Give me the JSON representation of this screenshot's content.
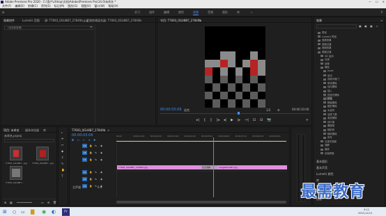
{
  "window": {
    "title": "Adobe Premiere Pro 2020 - C:\\用户\\cfdrop\\文档\\Adobe\\Premiere Pro\\14.0\\未命名 *",
    "controls": [
      "—",
      "☐",
      "✕"
    ]
  },
  "menu": [
    "文件(F)",
    "编辑(E)",
    "剪辑(C)",
    "序列(S)",
    "标记(M)",
    "图形(G)",
    "视图(V)",
    "窗口(W)",
    "帮助(H)"
  ],
  "workspaces": {
    "tabs": [
      "学习",
      "组件",
      "编辑",
      "颜色",
      "效果",
      "音频",
      "图形",
      "库"
    ],
    "active": "效果",
    "more": "»"
  },
  "effect_controls_panel": {
    "tabs": [
      "效果控件",
      "Lumetri 范围",
      "源: T7693_0GU8B7_27849b.jpg",
      "音频剪辑混合器: T7693_0GU8B7_27849b"
    ],
    "menu_icon": "≡",
    "clip_select": "（未选择剪辑）"
  },
  "program_monitor": {
    "tab": "节目: T7693_0GU8B7_27849b",
    "menu_icon": "≡",
    "current_time": "00:00:03:06",
    "fit": "适合",
    "quality": "1/2",
    "duration": "00:00:10:00",
    "transport_icons": [
      "▸|",
      "{",
      "}",
      "|◂",
      "◂|",
      "▶",
      "|▸",
      "→|",
      "⊡",
      "⊟",
      "📷",
      "+"
    ]
  },
  "project_panel": {
    "tabs": [
      "项目: 未命名",
      "媒体浏览器",
      "库",
      "信息"
    ],
    "file": "未命名.prproj",
    "items": [
      {
        "name": "T7693_0GU8B7...jpg",
        "duration": "5:00"
      },
      {
        "name": "T7693_0GU8B7...jpg",
        "duration": "5:00"
      },
      {
        "name": "T7693_0GU8B7...",
        "duration": "10:00"
      }
    ]
  },
  "tools": [
    "▸",
    "⇹",
    "↔",
    "◆",
    "↕",
    "✎",
    "✋",
    "T"
  ],
  "timeline": {
    "tab": "T7693_0GU8B7_27849b",
    "menu_icon": "≡",
    "current_time": "00:00:03:06",
    "ruler": [
      "00:00",
      "00:00:01:00",
      "00:00:02:00",
      "00:00:03:00",
      "00:00:04:00",
      "00:00:05:00",
      "00:00:06:00",
      "00:00:07:00",
      "00:00:08:00",
      "00:00:09:00"
    ],
    "tracks": [
      {
        "id": "V3",
        "label": "V3"
      },
      {
        "id": "V2",
        "label": "V2"
      },
      {
        "id": "V1",
        "label": "V1"
      },
      {
        "id": "A1",
        "label": "A1"
      },
      {
        "id": "A2",
        "label": "A2"
      },
      {
        "id": "A3",
        "label": "A3"
      }
    ],
    "master": {
      "label": "主声道",
      "value": "0.0"
    },
    "clips": [
      {
        "name": "T7693_0GU8B7_27849b.jpg",
        "color": "#e08ee0"
      },
      {
        "name": "交叉溶解",
        "color": "#b49cb4"
      },
      {
        "name": "Image0012B7-jpg",
        "color": "#e08ee0"
      }
    ]
  },
  "effects_panel": {
    "tab": "效果",
    "menu_icon": "≡",
    "search_placeholder": "",
    "tree": [
      "预设",
      "Lumetri 预设",
      "音频效果",
      "音频过渡",
      "视频效果",
      "视频过渡",
      "3D 运动",
      "内滑",
      "划像",
      "擦除",
      "Inset",
      "划出",
      "双侧平推门",
      "带状擦除",
      "径向擦除",
      "插入",
      "时钟式擦除",
      "棋盘",
      "棋盘擦除",
      "楔形擦除",
      "水波块",
      "油漆飞溅",
      "渐变擦除",
      "百叶窗",
      "螺旋框",
      "随机块",
      "随机擦除",
      "风车",
      "沉浸式视频",
      "溶解",
      "缩放",
      "页面剥落"
    ],
    "bottom_items": [
      "基本图形",
      "基本声音",
      "Lumetri 颜色",
      "库",
      "标记",
      "历史记录",
      "信息"
    ]
  },
  "taskbar": {
    "time": "9:12",
    "date": "2021/11/12",
    "search_placeholder": "在这里输入你要搜索的内容"
  },
  "watermark": "最需教育",
  "colors": {
    "accent": "#4d8ef0",
    "clip": "#e08ee0",
    "transition": "#b49cb4",
    "playhead": "#4d8ef0"
  }
}
